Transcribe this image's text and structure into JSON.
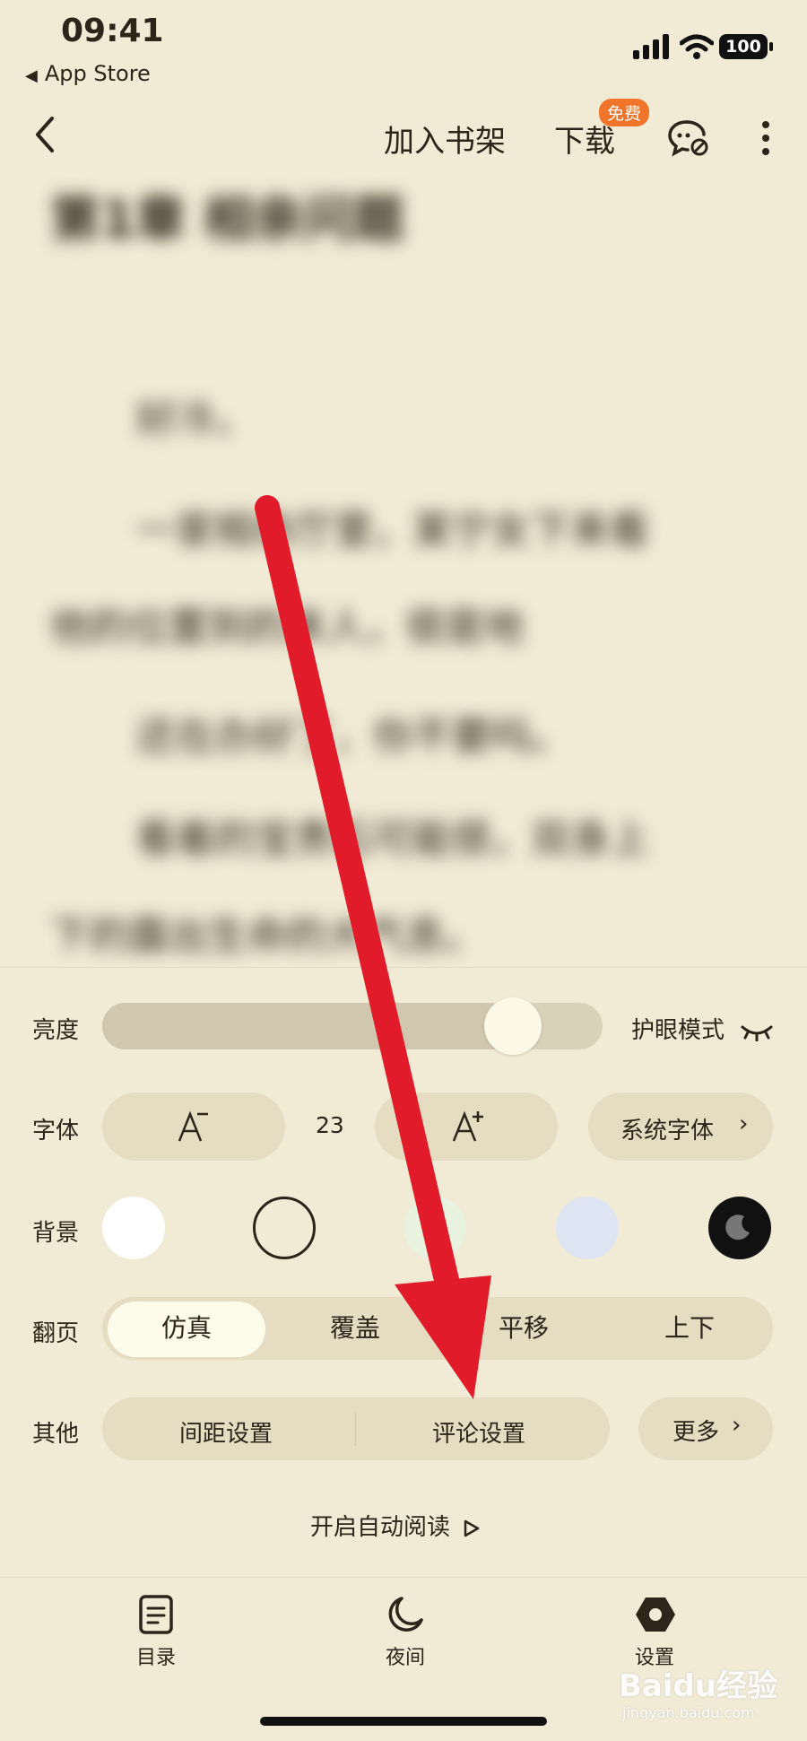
{
  "status_bar": {
    "time": "09:41",
    "back_app": "App Store",
    "battery": "100"
  },
  "nav": {
    "add_to_shelf": "加入书架",
    "download": "下载",
    "free_badge": "免费"
  },
  "reading": {
    "chapter": "第1章 相亲问题",
    "paragraphs": [
      "好冷。",
      "一家相亲厅里，某宁女下来看",
      "他的位置到的来人，很是地",
      "还在办好了，你不要吗。",
      "看着的宝贵石可能很，双身上",
      "下的露出生命的大气息。"
    ]
  },
  "settings": {
    "brightness_label": "亮度",
    "brightness_level": 0.82,
    "eye_mode_label": "护眼模式",
    "font_label": "字体",
    "font_size": "23",
    "system_font": "系统字体",
    "background_label": "背景",
    "backgrounds": [
      "#ffffff",
      "#f1ead4",
      "#e8f2df",
      "#dde5f2",
      "#111111"
    ],
    "page_turn_label": "翻页",
    "page_turn_options": [
      "仿真",
      "覆盖",
      "平移",
      "上下"
    ],
    "page_turn_selected": "仿真",
    "other_label": "其他",
    "spacing_settings": "间距设置",
    "comment_settings": "评论设置",
    "more": "更多",
    "auto_read": "开启自动阅读"
  },
  "tabs": [
    {
      "label": "目录"
    },
    {
      "label": "夜间"
    },
    {
      "label": "设置"
    }
  ],
  "watermark": {
    "logo": "Baidu经验",
    "url": "jingyan.baidu.com"
  },
  "colors": {
    "annotation_arrow": "#e21b2a",
    "badge": "#f0742a"
  }
}
